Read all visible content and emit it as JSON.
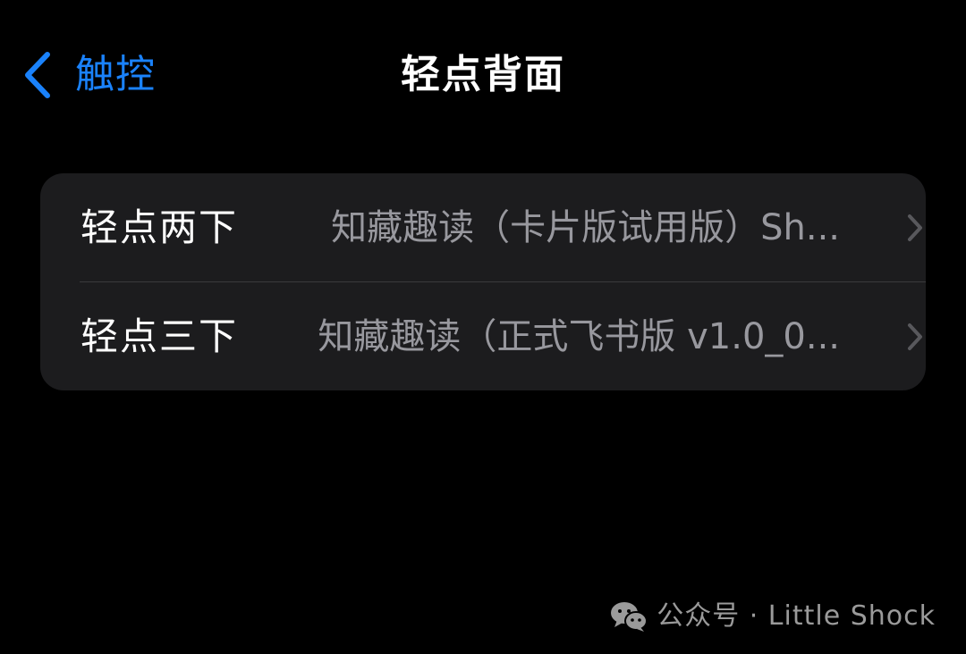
{
  "navbar": {
    "back_label": "触控",
    "title": "轻点背面"
  },
  "settings": {
    "rows": [
      {
        "title": "轻点两下",
        "value": "知藏趣读（卡片版试用版）Sh..."
      },
      {
        "title": "轻点三下",
        "value": "知藏趣读（正式飞书版 v1.0_0..."
      }
    ]
  },
  "watermark": {
    "text": "公众号 · Little Shock"
  },
  "icons": {
    "back": "chevron-left-icon",
    "row_disclosure": "chevron-right-icon",
    "watermark": "wechat-icon"
  },
  "colors": {
    "background": "#000000",
    "group_background": "#1c1c1e",
    "divider": "#3a3a3c",
    "accent_blue": "#1a82fb",
    "primary_text": "#ffffff",
    "secondary_text": "#98989e",
    "chevron": "#58585c",
    "watermark_text": "#9a9a9a"
  }
}
